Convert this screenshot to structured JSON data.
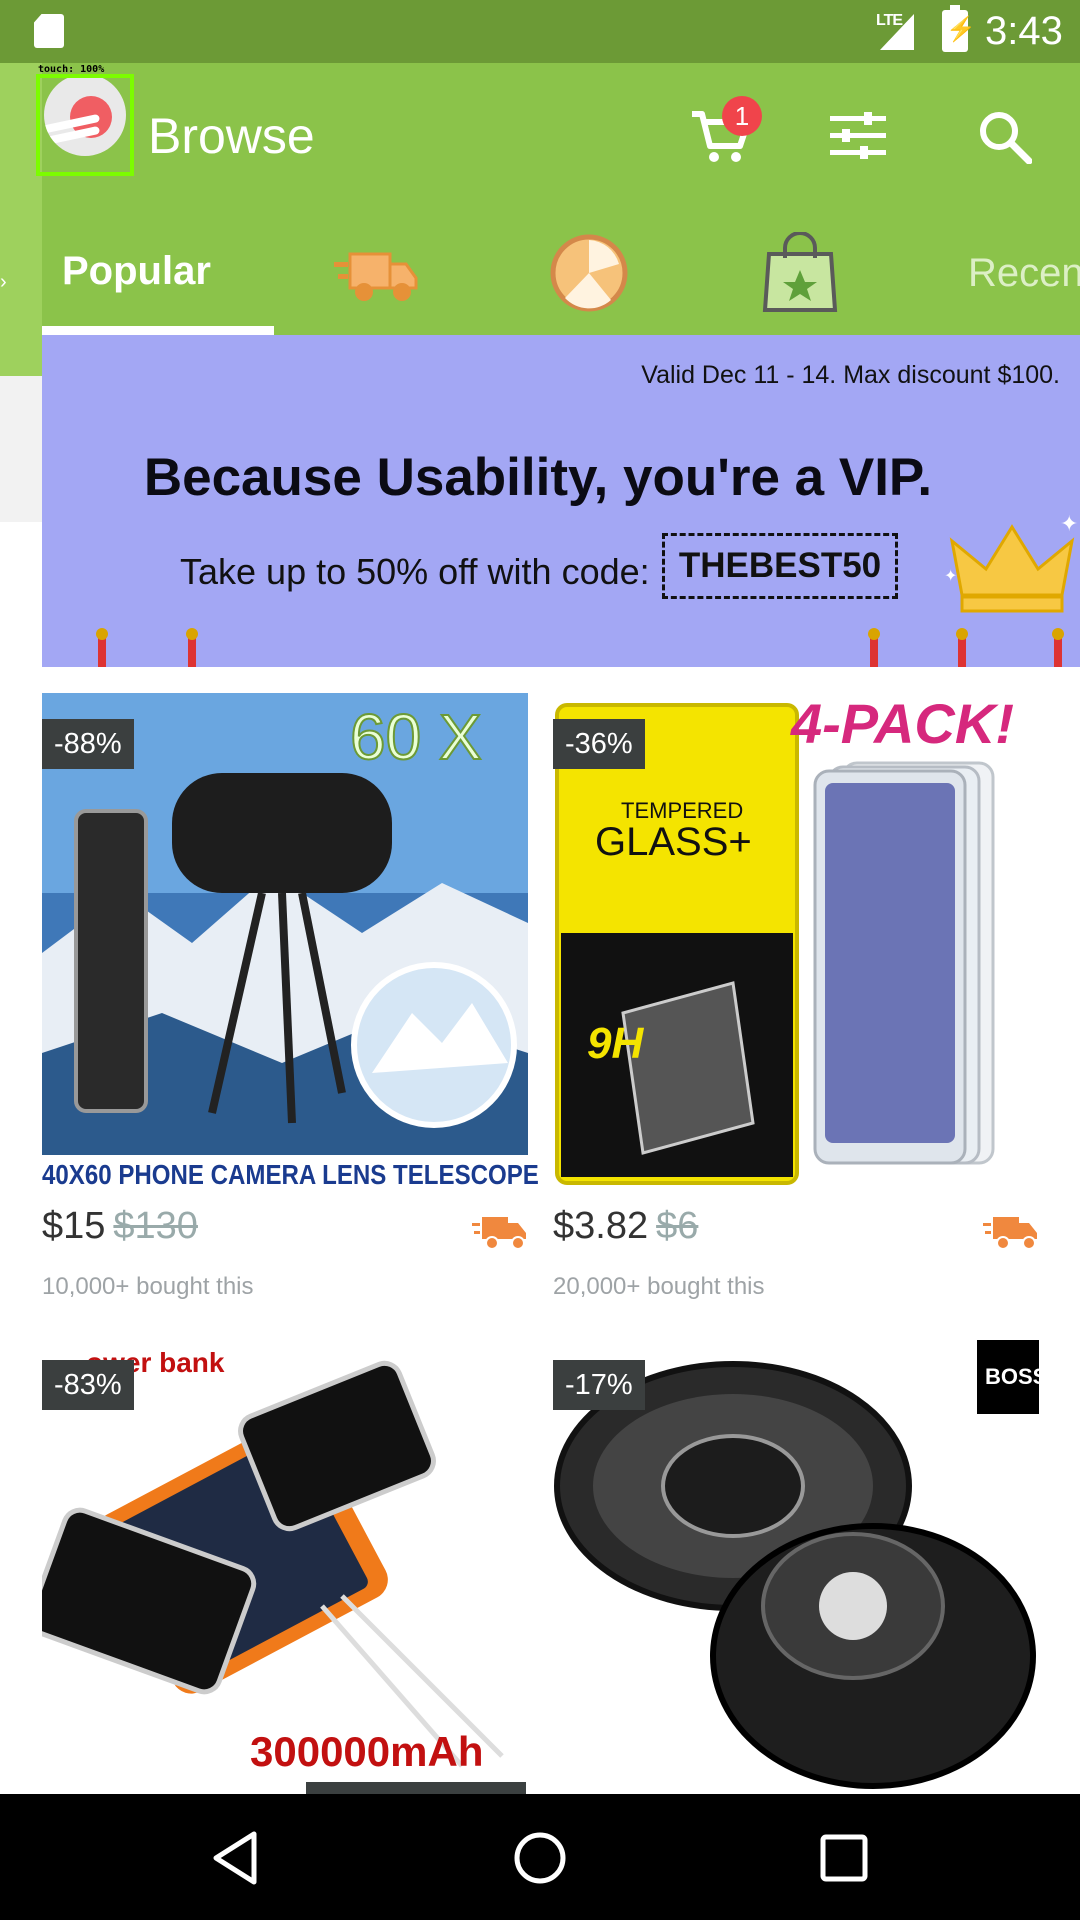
{
  "status_bar": {
    "time": "3:43",
    "network": "LTE"
  },
  "debug": {
    "touch_label": "touch: 100%"
  },
  "app_bar": {
    "title": "Browse",
    "cart_count": "1"
  },
  "tabs": {
    "popular": "Popular",
    "recent": "Recen"
  },
  "banner": {
    "valid_text": "Valid Dec 11 - 14. Max discount $100.",
    "headline": "Because Usability, you're a VIP.",
    "offer_text": "Take up to 50% off with code:",
    "code": "THEBEST50"
  },
  "products": [
    {
      "discount": "-88%",
      "price": "$15",
      "old_price": "$130",
      "bought": "10,000+ bought this",
      "image_caption": "40X60  PHONE CAMERA LENS TELESCOPE",
      "image_overlay": "60 X"
    },
    {
      "discount": "-36%",
      "price": "$3.82",
      "old_price": "$6",
      "bought": "20,000+ bought this",
      "image_overlay": "4-PACK!",
      "image_label_1": "TEMPERED",
      "image_label_2": "GLASS+"
    },
    {
      "discount": "-83%",
      "image_overlay": "ower bank",
      "image_caption": "300000mAh"
    },
    {
      "discount": "-17%",
      "image_logo": "BOSS"
    }
  ],
  "colors": {
    "primary": "#8bc34a",
    "status_bar": "#6c9a36",
    "banner_bg": "#a3a7f4",
    "badge_bg": "#3b3f3f",
    "cart_badge": "#f0444b"
  }
}
